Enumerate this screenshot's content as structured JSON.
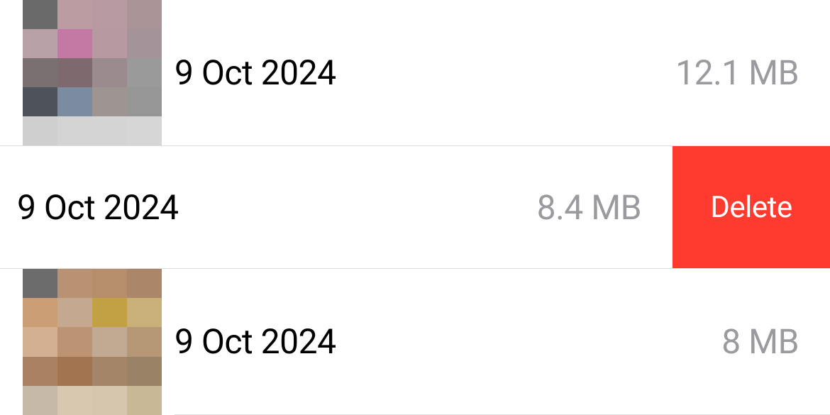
{
  "rows": [
    {
      "date": "9 Oct 2024",
      "size": "12.1 MB",
      "has_thumbnail": true,
      "swiped": false,
      "thumb_colors": [
        "#6a6a6a",
        "#bc9ca3",
        "#b79aa2",
        "#aa9498",
        "#b8a2a8",
        "#c379a3",
        "#b79aa1",
        "#a49398",
        "#7a6f71",
        "#7e6a6e",
        "#9c8b8e",
        "#9a9a9a",
        "#4e525a",
        "#7b8ca0",
        "#9e9492",
        "#969696",
        "#cfcfcf",
        "#d4d4d4",
        "#d4d4d4",
        "#d6d6d6"
      ]
    },
    {
      "date": "9 Oct 2024",
      "size": "8.4 MB",
      "has_thumbnail": false,
      "swiped": true,
      "delete_label": "Delete"
    },
    {
      "date": "9 Oct 2024",
      "size": "8 MB",
      "has_thumbnail": true,
      "swiped": false,
      "thumb_colors": [
        "#6c6c6c",
        "#b89272",
        "#b78e6b",
        "#ab8668",
        "#cc9e75",
        "#c4a990",
        "#c2a044",
        "#c8b078",
        "#d4b092",
        "#bd9473",
        "#c2a991",
        "#b79876",
        "#aa8262",
        "#a27550",
        "#a58568",
        "#9a8266",
        "#c6b8a6",
        "#d8c8b0",
        "#d6c6ae",
        "#c8b896"
      ]
    }
  ]
}
